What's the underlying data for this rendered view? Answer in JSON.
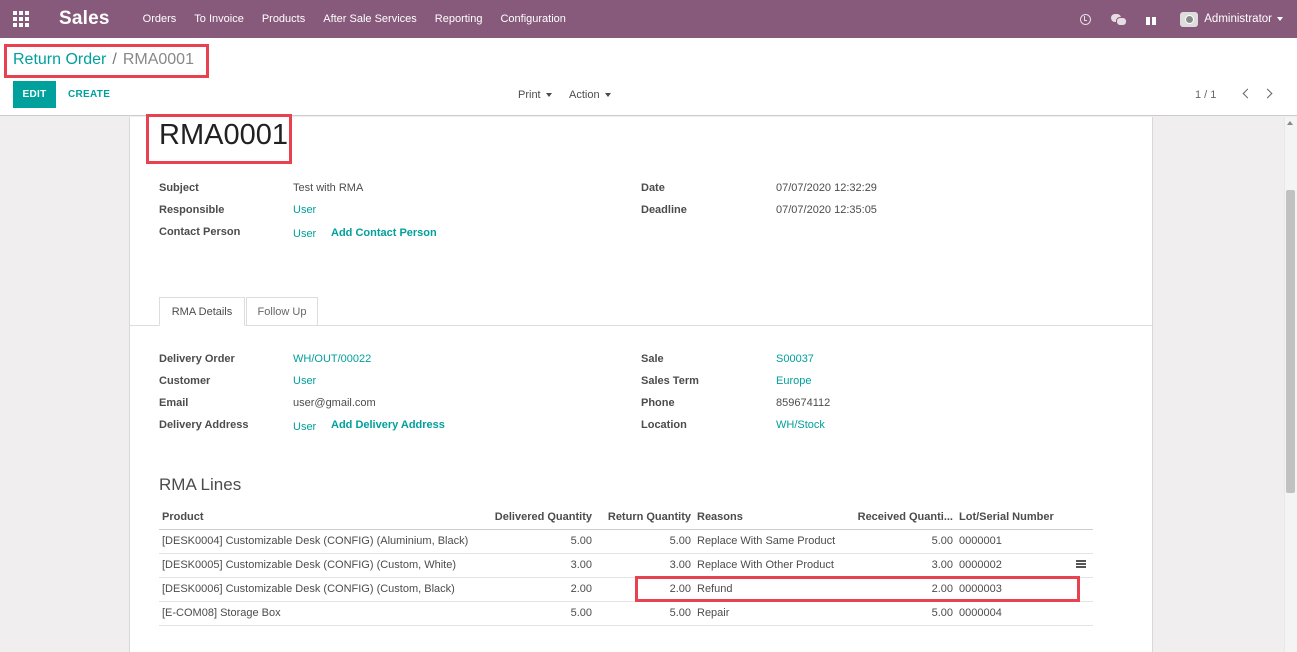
{
  "navbar": {
    "app_name": "Sales",
    "menu": [
      "Orders",
      "To Invoice",
      "Products",
      "After Sale Services",
      "Reporting",
      "Configuration"
    ],
    "user": "Administrator",
    "icons": [
      "apps-icon",
      "clock-icon",
      "chat-icon",
      "gift-icon",
      "avatar"
    ]
  },
  "breadcrumb": {
    "parent": "Return Order",
    "separator": "/",
    "current": "RMA0001"
  },
  "toolbar": {
    "edit_label": "EDIT",
    "create_label": "CREATE",
    "print_label": "Print",
    "action_label": "Action",
    "pager": "1 / 1"
  },
  "record": {
    "title": "RMA0001",
    "subject_label": "Subject",
    "subject": "Test with RMA",
    "responsible_label": "Responsible",
    "responsible": "User",
    "contact_label": "Contact Person",
    "contact": "User",
    "add_contact": "Add Contact Person",
    "date_label": "Date",
    "date": "07/07/2020 12:32:29",
    "deadline_label": "Deadline",
    "deadline": "07/07/2020 12:35:05"
  },
  "tabs": [
    "RMA Details",
    "Follow Up"
  ],
  "details": {
    "delivery_order_label": "Delivery Order",
    "delivery_order": "WH/OUT/00022",
    "customer_label": "Customer",
    "customer": "User",
    "email_label": "Email",
    "email": "user@gmail.com",
    "delivery_address_label": "Delivery Address",
    "delivery_address": "User",
    "add_delivery_address": "Add Delivery Address",
    "sale_label": "Sale",
    "sale": "S00037",
    "sales_term_label": "Sales Term",
    "sales_term": "Europe",
    "phone_label": "Phone",
    "phone": "859674112",
    "location_label": "Location",
    "location": "WH/Stock"
  },
  "rma_lines": {
    "title": "RMA Lines",
    "columns": [
      "Product",
      "Delivered Quantity",
      "Return Quantity",
      "Reasons",
      "Received Quanti...",
      "Lot/Serial Number"
    ],
    "rows": [
      [
        "[DESK0004] Customizable Desk (CONFIG) (Aluminium, Black)",
        "5.00",
        "5.00",
        "Replace With Same Product",
        "5.00",
        "0000001"
      ],
      [
        "[DESK0005] Customizable Desk (CONFIG) (Custom, White)",
        "3.00",
        "3.00",
        "Replace With Other Product",
        "3.00",
        "0000002"
      ],
      [
        "[DESK0006] Customizable Desk (CONFIG) (Custom, Black)",
        "2.00",
        "2.00",
        "Refund",
        "2.00",
        "0000003"
      ],
      [
        "[E-COM08] Storage Box",
        "5.00",
        "5.00",
        "Repair",
        "5.00",
        "0000004"
      ]
    ]
  },
  "colors": {
    "navbar": "#875a7b",
    "accent": "#00a09d",
    "annotation": "#e8414f"
  }
}
